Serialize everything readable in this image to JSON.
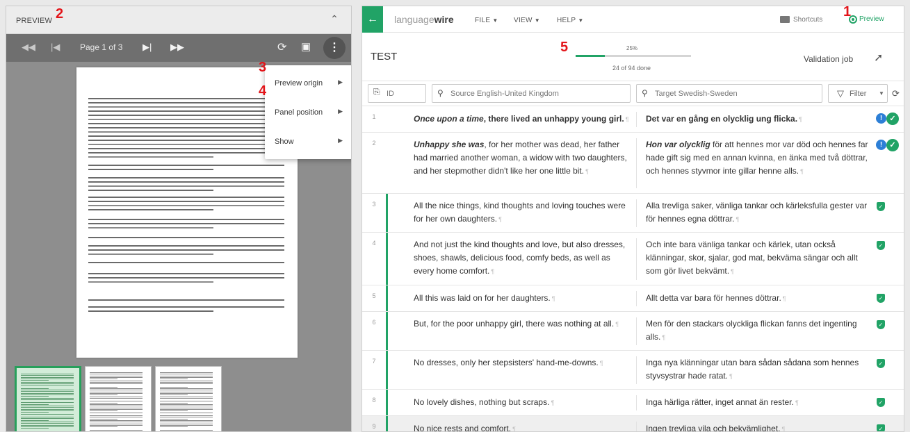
{
  "annotations": {
    "a1": "1",
    "a2": "2",
    "a3": "3",
    "a4": "4",
    "a5": "5"
  },
  "preview_panel": {
    "title": "PREVIEW",
    "collapse_icon": "chevron-up-icon",
    "page_info": "Page 1 of 3",
    "toolbar_icons": [
      "first-page-icon",
      "prev-page-icon",
      "next-page-icon",
      "last-page-icon",
      "reload-icon",
      "open-external-icon",
      "more-vertical-icon"
    ],
    "menu": {
      "items": [
        {
          "label": "Preview origin"
        },
        {
          "label": "Panel position"
        },
        {
          "label": "Show"
        }
      ]
    }
  },
  "topbar": {
    "brand_light": "language",
    "brand_bold": "wire",
    "menus": [
      "FILE",
      "VIEW",
      "HELP"
    ],
    "shortcuts": "Shortcuts",
    "preview": "Preview"
  },
  "job": {
    "title": "TEST",
    "progress_percent": 25,
    "progress_label": "25%",
    "done_label": "24 of 94 done",
    "type": "Validation job"
  },
  "search": {
    "id_placeholder": "ID",
    "source_placeholder": "Source English-United Kingdom",
    "target_placeholder": "Target Swedish-Sweden",
    "filter_label": "Filter"
  },
  "segments": [
    {
      "num": "1",
      "src_em": "Once upon a time",
      "src": ", there lived an unhappy young girl.",
      "tgt_em": "",
      "tgt": "Det var en gång en olycklig ung flicka.",
      "status": "info-confirmed"
    },
    {
      "num": "2",
      "src_em": "Unhappy she was",
      "src": ", for her mother was dead, her father had married another woman, a widow with two daughters, and her stepmother didn't like her one little bit.",
      "tgt_em": "Hon var olycklig",
      "tgt": " för att hennes mor var död och hennes far hade gift sig med en annan kvinna, en änka med två döttrar, och hennes styvmor inte gillar henne alls.",
      "status": "info-confirmed"
    },
    {
      "num": "3",
      "src_em": "",
      "src": "All the nice things, kind thoughts and loving touches were for her own daughters.",
      "tgt_em": "",
      "tgt": "Alla trevliga saker, vänliga tankar och kärleksfulla gester var för hennes egna döttrar.",
      "status": "validated"
    },
    {
      "num": "4",
      "src_em": "",
      "src": "And not just the kind thoughts and love, but also dresses, shoes, shawls, delicious food, comfy beds, as well as every home comfort.",
      "tgt_em": "",
      "tgt": "Och inte bara vänliga tankar och kärlek, utan också klänningar, skor, sjalar, god mat, bekväma sängar och allt som gör livet bekvämt.",
      "status": "validated"
    },
    {
      "num": "5",
      "src_em": "",
      "src": "All this was laid on for her daughters.",
      "tgt_em": "",
      "tgt": "Allt detta var bara för hennes döttrar.",
      "status": "validated"
    },
    {
      "num": "6",
      "src_em": "",
      "src": "But, for the poor unhappy girl, there was nothing at all.",
      "tgt_em": "",
      "tgt": "Men för den stackars olyckliga flickan fanns det ingenting alls.",
      "status": "validated"
    },
    {
      "num": "7",
      "src_em": "",
      "src": "No dresses, only her stepsisters' hand-me-downs.",
      "tgt_em": "",
      "tgt": "Inga nya klänningar utan bara sådan sådana som hennes styvsystrar hade ratat.",
      "status": "validated"
    },
    {
      "num": "8",
      "src_em": "",
      "src": "No lovely dishes, nothing but scraps.",
      "tgt_em": "",
      "tgt": "Inga härliga rätter, inget annat än rester.",
      "status": "validated"
    },
    {
      "num": "9",
      "src_em": "",
      "src": "No nice rests and comfort.",
      "tgt_em": "",
      "tgt": "Ingen trevliga vila och bekvämlighet.",
      "status": "validated"
    }
  ],
  "colors": {
    "accent": "#21a366",
    "info": "#2d7fd6",
    "annotation": "#e3151a"
  }
}
